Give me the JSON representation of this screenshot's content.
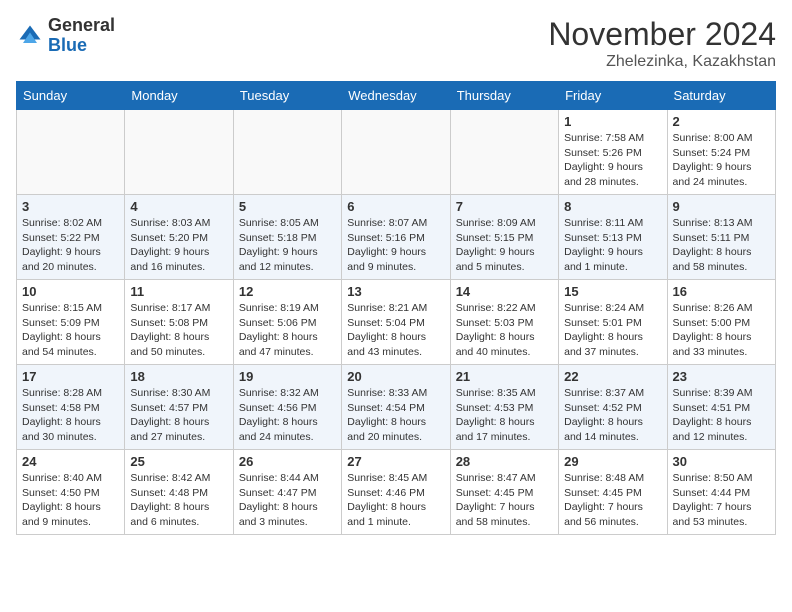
{
  "logo": {
    "general": "General",
    "blue": "Blue"
  },
  "title": "November 2024",
  "location": "Zhelezinka, Kazakhstan",
  "weekdays": [
    "Sunday",
    "Monday",
    "Tuesday",
    "Wednesday",
    "Thursday",
    "Friday",
    "Saturday"
  ],
  "weeks": [
    [
      {
        "day": "",
        "info": ""
      },
      {
        "day": "",
        "info": ""
      },
      {
        "day": "",
        "info": ""
      },
      {
        "day": "",
        "info": ""
      },
      {
        "day": "",
        "info": ""
      },
      {
        "day": "1",
        "info": "Sunrise: 7:58 AM\nSunset: 5:26 PM\nDaylight: 9 hours\nand 28 minutes."
      },
      {
        "day": "2",
        "info": "Sunrise: 8:00 AM\nSunset: 5:24 PM\nDaylight: 9 hours\nand 24 minutes."
      }
    ],
    [
      {
        "day": "3",
        "info": "Sunrise: 8:02 AM\nSunset: 5:22 PM\nDaylight: 9 hours\nand 20 minutes."
      },
      {
        "day": "4",
        "info": "Sunrise: 8:03 AM\nSunset: 5:20 PM\nDaylight: 9 hours\nand 16 minutes."
      },
      {
        "day": "5",
        "info": "Sunrise: 8:05 AM\nSunset: 5:18 PM\nDaylight: 9 hours\nand 12 minutes."
      },
      {
        "day": "6",
        "info": "Sunrise: 8:07 AM\nSunset: 5:16 PM\nDaylight: 9 hours\nand 9 minutes."
      },
      {
        "day": "7",
        "info": "Sunrise: 8:09 AM\nSunset: 5:15 PM\nDaylight: 9 hours\nand 5 minutes."
      },
      {
        "day": "8",
        "info": "Sunrise: 8:11 AM\nSunset: 5:13 PM\nDaylight: 9 hours\nand 1 minute."
      },
      {
        "day": "9",
        "info": "Sunrise: 8:13 AM\nSunset: 5:11 PM\nDaylight: 8 hours\nand 58 minutes."
      }
    ],
    [
      {
        "day": "10",
        "info": "Sunrise: 8:15 AM\nSunset: 5:09 PM\nDaylight: 8 hours\nand 54 minutes."
      },
      {
        "day": "11",
        "info": "Sunrise: 8:17 AM\nSunset: 5:08 PM\nDaylight: 8 hours\nand 50 minutes."
      },
      {
        "day": "12",
        "info": "Sunrise: 8:19 AM\nSunset: 5:06 PM\nDaylight: 8 hours\nand 47 minutes."
      },
      {
        "day": "13",
        "info": "Sunrise: 8:21 AM\nSunset: 5:04 PM\nDaylight: 8 hours\nand 43 minutes."
      },
      {
        "day": "14",
        "info": "Sunrise: 8:22 AM\nSunset: 5:03 PM\nDaylight: 8 hours\nand 40 minutes."
      },
      {
        "day": "15",
        "info": "Sunrise: 8:24 AM\nSunset: 5:01 PM\nDaylight: 8 hours\nand 37 minutes."
      },
      {
        "day": "16",
        "info": "Sunrise: 8:26 AM\nSunset: 5:00 PM\nDaylight: 8 hours\nand 33 minutes."
      }
    ],
    [
      {
        "day": "17",
        "info": "Sunrise: 8:28 AM\nSunset: 4:58 PM\nDaylight: 8 hours\nand 30 minutes."
      },
      {
        "day": "18",
        "info": "Sunrise: 8:30 AM\nSunset: 4:57 PM\nDaylight: 8 hours\nand 27 minutes."
      },
      {
        "day": "19",
        "info": "Sunrise: 8:32 AM\nSunset: 4:56 PM\nDaylight: 8 hours\nand 24 minutes."
      },
      {
        "day": "20",
        "info": "Sunrise: 8:33 AM\nSunset: 4:54 PM\nDaylight: 8 hours\nand 20 minutes."
      },
      {
        "day": "21",
        "info": "Sunrise: 8:35 AM\nSunset: 4:53 PM\nDaylight: 8 hours\nand 17 minutes."
      },
      {
        "day": "22",
        "info": "Sunrise: 8:37 AM\nSunset: 4:52 PM\nDaylight: 8 hours\nand 14 minutes."
      },
      {
        "day": "23",
        "info": "Sunrise: 8:39 AM\nSunset: 4:51 PM\nDaylight: 8 hours\nand 12 minutes."
      }
    ],
    [
      {
        "day": "24",
        "info": "Sunrise: 8:40 AM\nSunset: 4:50 PM\nDaylight: 8 hours\nand 9 minutes."
      },
      {
        "day": "25",
        "info": "Sunrise: 8:42 AM\nSunset: 4:48 PM\nDaylight: 8 hours\nand 6 minutes."
      },
      {
        "day": "26",
        "info": "Sunrise: 8:44 AM\nSunset: 4:47 PM\nDaylight: 8 hours\nand 3 minutes."
      },
      {
        "day": "27",
        "info": "Sunrise: 8:45 AM\nSunset: 4:46 PM\nDaylight: 8 hours\nand 1 minute."
      },
      {
        "day": "28",
        "info": "Sunrise: 8:47 AM\nSunset: 4:45 PM\nDaylight: 7 hours\nand 58 minutes."
      },
      {
        "day": "29",
        "info": "Sunrise: 8:48 AM\nSunset: 4:45 PM\nDaylight: 7 hours\nand 56 minutes."
      },
      {
        "day": "30",
        "info": "Sunrise: 8:50 AM\nSunset: 4:44 PM\nDaylight: 7 hours\nand 53 minutes."
      }
    ]
  ]
}
